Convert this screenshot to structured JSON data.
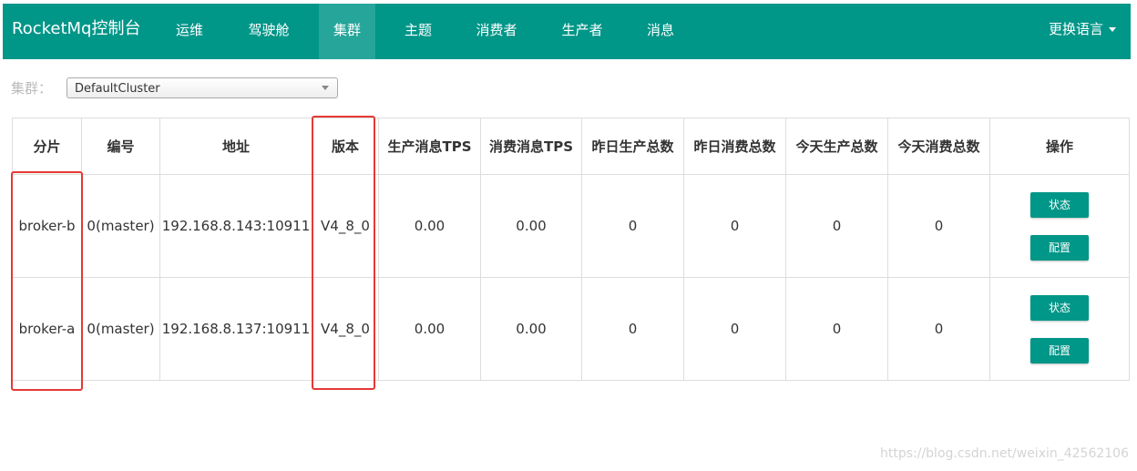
{
  "navbar": {
    "brand": "RocketMq控制台",
    "items": [
      {
        "label": "运维",
        "active": false
      },
      {
        "label": "驾驶舱",
        "active": false
      },
      {
        "label": "集群",
        "active": true
      },
      {
        "label": "主题",
        "active": false
      },
      {
        "label": "消费者",
        "active": false
      },
      {
        "label": "生产者",
        "active": false
      },
      {
        "label": "消息",
        "active": false
      }
    ],
    "language_label": "更换语言"
  },
  "filter": {
    "label": "集群：",
    "selected": "DefaultCluster"
  },
  "table": {
    "headers": {
      "shard": "分片",
      "id": "编号",
      "address": "地址",
      "version": "版本",
      "produce_tps": "生产消息TPS",
      "consume_tps": "消费消息TPS",
      "yesterday_produce": "昨日生产总数",
      "yesterday_consume": "昨日消费总数",
      "today_produce": "今天生产总数",
      "today_consume": "今天消费总数",
      "actions": "操作"
    },
    "rows": [
      {
        "broker": "broker-b",
        "id": "0(master)",
        "address": "192.168.8.143:10911",
        "version": "V4_8_0",
        "produce_tps": "0.00",
        "consume_tps": "0.00",
        "yesterday_produce": "0",
        "yesterday_consume": "0",
        "today_produce": "0",
        "today_consume": "0",
        "status_btn": "状态",
        "config_btn": "配置"
      },
      {
        "broker": "broker-a",
        "id": "0(master)",
        "address": "192.168.8.137:10911",
        "version": "V4_8_0",
        "produce_tps": "0.00",
        "consume_tps": "0.00",
        "yesterday_produce": "0",
        "yesterday_consume": "0",
        "today_produce": "0",
        "today_consume": "0",
        "status_btn": "状态",
        "config_btn": "配置"
      }
    ]
  },
  "watermark": "https://blog.csdn.net/weixin_42562106",
  "colors": {
    "primary": "#009688",
    "active_tab": "#26a69a",
    "highlight": "#e53935"
  }
}
